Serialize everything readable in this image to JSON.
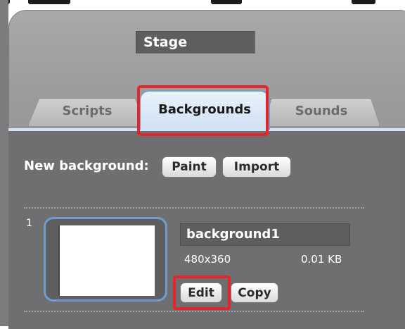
{
  "stage": {
    "name": "Stage"
  },
  "tabs": [
    {
      "label": "Scripts",
      "active": false
    },
    {
      "label": "Backgrounds",
      "active": true
    },
    {
      "label": "Sounds",
      "active": false
    }
  ],
  "new_background": {
    "label": "New background:",
    "paint_label": "Paint",
    "import_label": "Import"
  },
  "backgrounds": [
    {
      "index": "1",
      "name": "background1",
      "dimensions": "480x360",
      "size": "0.01 KB",
      "edit_label": "Edit",
      "copy_label": "Copy"
    }
  ],
  "colors": {
    "highlight": "#e4262b",
    "active_tab": "#cfe1f3",
    "panel": "#6f6f72"
  }
}
